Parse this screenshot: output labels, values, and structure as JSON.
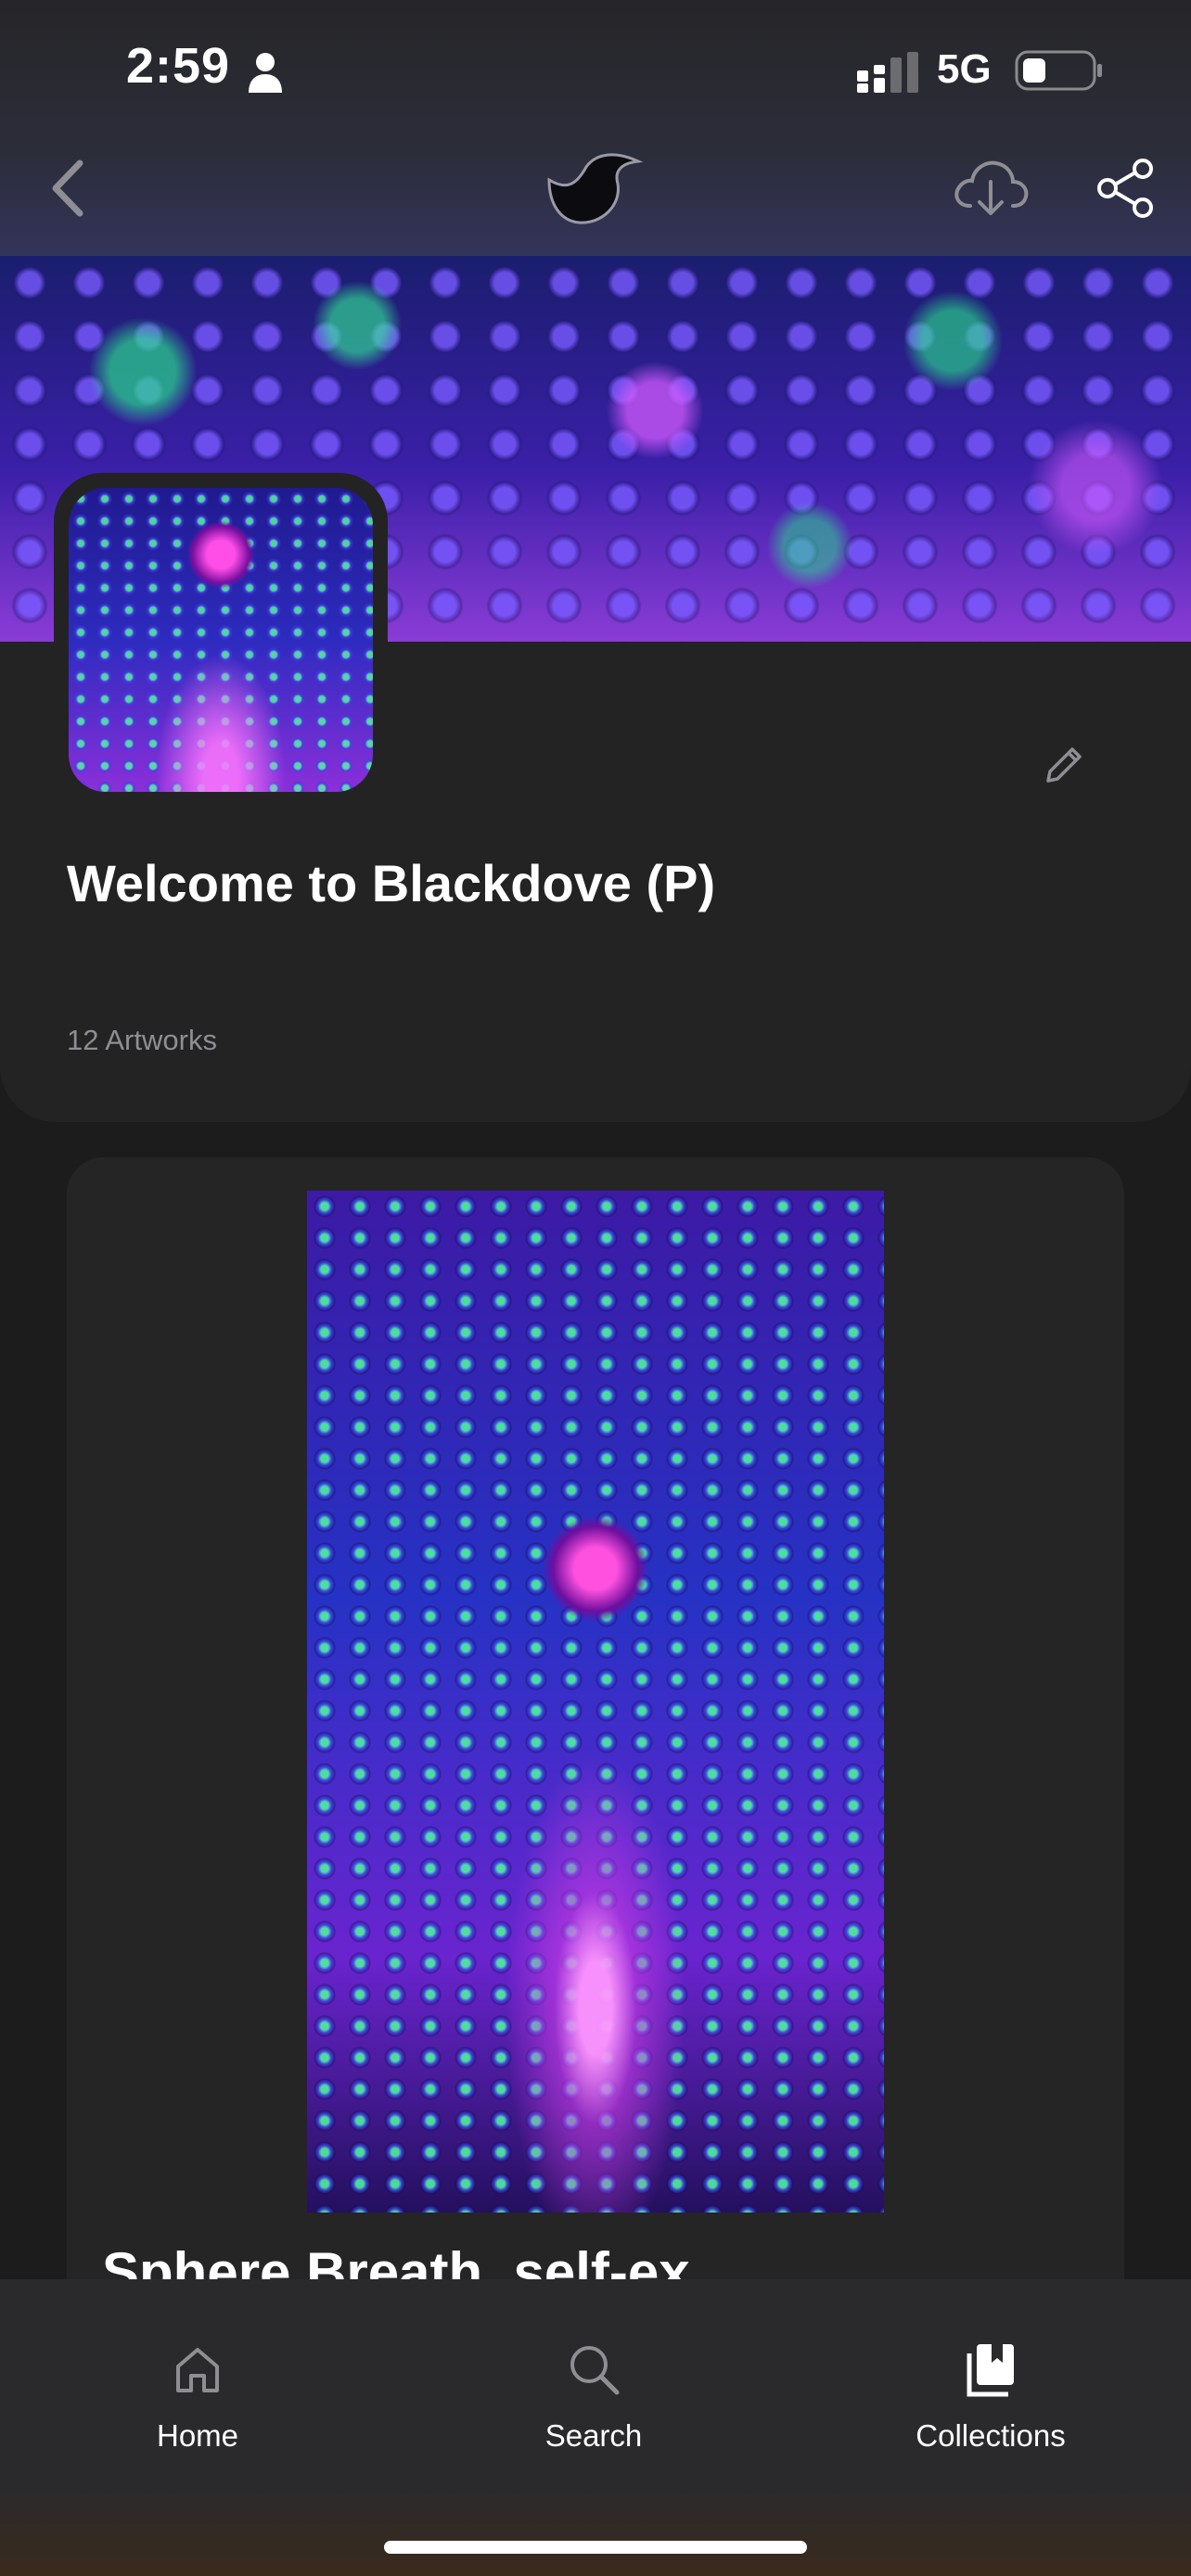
{
  "status_bar": {
    "time": "2:59",
    "network": "5G",
    "icons": [
      "person-icon",
      "signal-icon",
      "battery-icon"
    ]
  },
  "header": {
    "icons": [
      "back-chevron-icon",
      "blackdove-logo-icon",
      "cloud-download-icon",
      "share-icon"
    ]
  },
  "collection": {
    "title": "Welcome to Blackdove (P)",
    "artwork_count": "12 Artworks",
    "edit_icon": "pencil-icon"
  },
  "artwork": {
    "title": "Sphere Breath, self-ex"
  },
  "tabbar": {
    "items": [
      {
        "label": "Home",
        "icon": "home-icon"
      },
      {
        "label": "Search",
        "icon": "search-icon"
      },
      {
        "label": "Collections",
        "icon": "collections-icon"
      }
    ],
    "active": "Collections"
  },
  "colors": {
    "background": "#1c1c1d",
    "card": "#232324",
    "muted_text": "#8e8e93",
    "accent_banner": "#3a1fa8"
  }
}
